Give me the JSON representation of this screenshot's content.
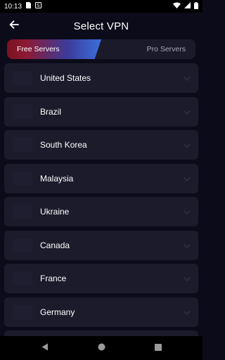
{
  "status_bar": {
    "time": "10:13",
    "left_icons": [
      "document-icon",
      "s-app-icon"
    ],
    "right_icons": [
      "wifi-icon",
      "signal-icon",
      "battery-icon"
    ]
  },
  "header": {
    "title": "Select VPN",
    "back_icon": "arrow-left-icon"
  },
  "tabs": {
    "free_label": "Free Servers",
    "pro_label": "Pro Servers",
    "selected": "free"
  },
  "servers": [
    {
      "name": "United States"
    },
    {
      "name": "Brazil"
    },
    {
      "name": "South Korea"
    },
    {
      "name": "Malaysia"
    },
    {
      "name": "Ukraine"
    },
    {
      "name": "Canada"
    },
    {
      "name": "France"
    },
    {
      "name": "Germany"
    }
  ],
  "nav_bar": {
    "icons": [
      "back-triangle-icon",
      "home-circle-icon",
      "recents-square-icon"
    ]
  },
  "colors": {
    "background": "#0c0b1a",
    "row": "#1c1b2c",
    "tab_gradient_start": "#7a1220",
    "tab_gradient_end": "#3d70dc",
    "muted_text": "#a9a8b8"
  }
}
